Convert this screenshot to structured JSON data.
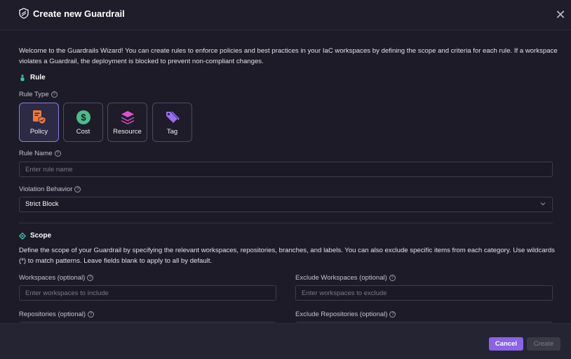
{
  "dialog": {
    "title": "Create new Guardrail",
    "close_label": "✕"
  },
  "intro": "Welcome to the Guardrails Wizard! You can create rules to enforce policies and best practices in your IaC workspaces by defining the scope and criteria for each rule. If a workspace violates a Guardrail, the deployment is blocked to prevent non-compliant changes.",
  "rule": {
    "section_title": "Rule",
    "rule_type_label": "Rule Type",
    "types": [
      {
        "label": "Policy",
        "icon": "policy-shield-icon",
        "color": "#f07a3a",
        "selected": true
      },
      {
        "label": "Cost",
        "icon": "dollar-coin-icon",
        "color": "#4cbb8a",
        "selected": false
      },
      {
        "label": "Resource",
        "icon": "stack-layers-icon",
        "color": "#e24fd0",
        "selected": false
      },
      {
        "label": "Tag",
        "icon": "tag-icon",
        "color": "#9b6cf0",
        "selected": false
      }
    ],
    "rule_name_label": "Rule Name",
    "rule_name_placeholder": "Enter rule name",
    "violation_label": "Violation Behavior",
    "violation_value": "Strict Block"
  },
  "scope": {
    "section_title": "Scope",
    "description": "Define the scope of your Guardrail by specifying the relevant workspaces, repositories, branches, and labels. You can also exclude specific items from each category. Use wildcards (*) to match patterns. Leave fields blank to apply to all by default.",
    "workspaces_label": "Workspaces (optional)",
    "workspaces_placeholder": "Enter workspaces to include",
    "exclude_workspaces_label": "Exclude Workspaces (optional)",
    "exclude_workspaces_placeholder": "Enter workspaces to exclude",
    "repositories_label": "Repositories (optional)",
    "exclude_repositories_label": "Exclude Repositories (optional)"
  },
  "footer": {
    "cancel_label": "Cancel",
    "create_label": "Create"
  },
  "colors": {
    "accent": "#8a63e8",
    "rule_icon": "#3fc1b0",
    "scope_icon": "#3fc1b0"
  }
}
